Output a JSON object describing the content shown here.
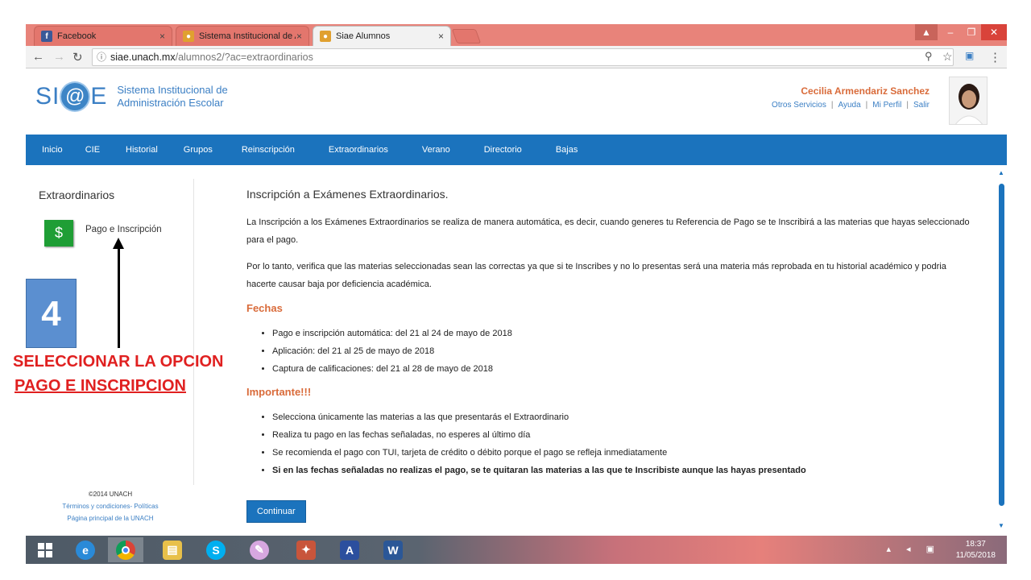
{
  "browser": {
    "tabs": [
      {
        "label": "Facebook",
        "icon": "facebook-icon",
        "active": false
      },
      {
        "label": "Sistema Institucional de A",
        "icon": "unach-icon",
        "active": false
      },
      {
        "label": "Siae Alumnos",
        "icon": "unach-icon",
        "active": true
      }
    ],
    "close_glyph": "×",
    "url_host": "siae.unach.mx",
    "url_path": "/alumnos2/?ac=extraordinarios"
  },
  "header": {
    "logo_text_left": "SI",
    "logo_at": "@",
    "logo_text_right": "E",
    "logo_sub_line1": "Sistema Institucional de",
    "logo_sub_line2": "Administración Escolar",
    "user_name": "Cecilia Armendariz Sanchez",
    "links": [
      "Otros Servicios",
      "Ayuda",
      "Mi Perfil",
      "Salir"
    ]
  },
  "nav": [
    "Inicio",
    "CIE",
    "Historial",
    "Grupos",
    "Reinscripción",
    "Extraordinarios",
    "Verano",
    "Directorio",
    "Bajas"
  ],
  "sidebar": {
    "title": "Extraordinarios",
    "item_icon": "$",
    "item_label": "Pago e Inscripción"
  },
  "footer": {
    "copyright": "©2014 UNACH",
    "terms": "Términos y condiciones- Políticas",
    "home": "Página principal de la UNACH"
  },
  "content": {
    "title": "Inscripción a Exámenes Extraordinarios.",
    "para1": "La Inscripción a los Exámenes Extraordinarios se realiza de manera automática, es decir, cuando generes tu Referencia de Pago se te Inscribirá a las materias que hayas seleccionado para el pago.",
    "para2": "Por lo tanto, verifica que las materias seleccionadas sean las correctas ya que si te Inscribes y no lo presentas será una materia más reprobada en tu historial académico y podria hacerte causar baja por deficiencia académica.",
    "fechas_title": "Fechas",
    "fechas": [
      "Pago e inscripción automática: del 21 al 24 de mayo de 2018",
      "Aplicación: del 21 al 25 de mayo de 2018",
      "Captura de calificaciones: del 21 al 28 de mayo de 2018"
    ],
    "importante_title": "Importante!!!",
    "importante": [
      "Selecciona únicamente las materias a las que presentarás el Extraordinario",
      "Realiza tu pago en las fechas señaladas, no esperes al último día",
      "Se recomienda el pago con TUI, tarjeta de crédito o débito porque el pago se refleja inmediatamente",
      "Si en las fechas señaladas no realizas el pago, se te quitaran las materias a las que te Inscribiste aunque las hayas presentado"
    ],
    "continue_label": "Continuar"
  },
  "annotation": {
    "step_number": "4",
    "line1": "SELECCIONAR LA OPCION",
    "line2": "PAGO E INSCRIPCION"
  },
  "taskbar": {
    "time": "18:37",
    "date": "11/05/2018",
    "apps": [
      "windows-start-icon",
      "internet-explorer-icon",
      "chrome-icon",
      "file-explorer-icon",
      "skype-icon",
      "paint-icon",
      "app-icon",
      "app-icon",
      "word-icon"
    ]
  },
  "colors": {
    "nav_blue": "#1b73bd",
    "accent_orange": "#d96b3a",
    "tab_bar": "#e8837a",
    "pay_green": "#1f9e35",
    "annotation_red": "#e02020"
  }
}
